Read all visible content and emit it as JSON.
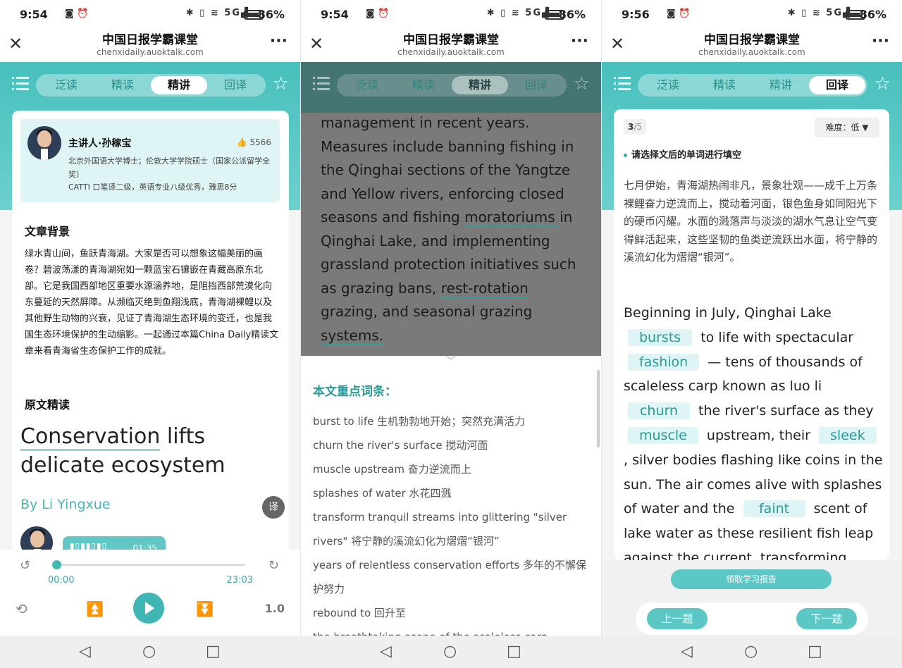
{
  "common": {
    "app_title": "中国日报学霸课堂",
    "app_url": "chenxidaily.auoktalk.com",
    "battery": "86%",
    "tabs": [
      "泛读",
      "精读",
      "精讲",
      "回译"
    ]
  },
  "p1": {
    "time": "9:54",
    "lecturer": {
      "name": "主讲人·孙稼宝",
      "likes": "5566",
      "desc1": "北京外国语大学博士；伦敦大学学院硕士（国家公派留学全奖）",
      "desc2": "CATTI 口笔译二级，英语专业八级优秀，雅思8分"
    },
    "bg_title": "文章背景",
    "bg_text": "绿水青山间，鱼跃青海湖。大家是否可以想象这幅美丽的画卷？碧波荡漾的青海湖宛如一颗蓝宝石镶嵌在青藏高原东北部。它是我国西部地区重要水源涵养地，是阻挡西部荒漠化向东蔓延的天然屏障。从濒临灭绝到鱼翔浅底，青海湖裸鲤以及其他野生动物的兴衰，见证了青海湖生态环境的变迁，也是我国生态环境保护的生动缩影。一起通过本篇China Daily精读文章来看青海省生态保护工作的成就。",
    "reading_title": "原文精读",
    "headline_a": "Conservation",
    "headline_b": " lifts delicate ecosystem",
    "byline": "By Li Yingxue",
    "translate_label": "译",
    "audio_duration": "01:35",
    "time_current": "00:00",
    "time_total": "23:03",
    "progress": 0.0,
    "speed": "1.0"
  },
  "p2": {
    "time": "9:54",
    "t1": "management in recent years. Measures include banning fishing in the Qinghai sections of the Yangtze and Yellow rivers, enforcing closed seasons and fishing ",
    "v1": "moratoriums ",
    "t2": "in Qinghai Lake, and implementing grassland protection initiatives such as grazing bans, ",
    "v2": "rest-rotation ",
    "t3": "grazing, and seasonal grazing ",
    "v3": "systems.",
    "sheet_title": "本文重点词条：",
    "vocab": [
      "burst to life 生机勃勃地开始；突然充满活力",
      "churn the river's surface 搅动河面",
      "muscle upstream 奋力逆流而上",
      "splashes of water 水花四溅",
      "transform tranquil streams into glittering \"silver rivers\" 将宁静的溪流幻化为熠熠“银河”",
      "years of relentless conservation efforts 多年的不懈保护努力",
      "rebound to 回升至",
      "the breathtaking scene of the scaleless carp"
    ]
  },
  "p3": {
    "time": "9:56",
    "progress_current": "3",
    "progress_total": "/5",
    "difficulty": "难度：低 ▼",
    "instruction": "请选择文后的单词进行填空",
    "cn_text": "七月伊始，青海湖热闹非凡，景象壮观——成千上万条裸鲤奋力逆流而上，搅动着河面，银色鱼身如同阳光下的硬币闪耀。水面的溅落声与淡淡的湖水气息让空气变得鲜活起来，这些坚韧的鱼类逆流跃出水面，将宁静的溪流幻化为熠熠“银河”。",
    "en": {
      "s1": "Beginning in July, Qinghai Lake",
      "b1": "bursts",
      "s2": "to life with spectacular",
      "b2": "fashion",
      "s3": "— tens of thousands of scaleless carp known as luo li",
      "b3": "churn",
      "s4": "the river's surface as they",
      "b4": "muscle",
      "s5": "upstream, their",
      "b5": "sleek",
      "s6": ", silver bodies flashing like coins in the sun. The air comes alive with splashes of water and the",
      "b6": "faint",
      "s7": "scent of lake water as these resilient fish leap against the current, transforming tranquil"
    },
    "report_label": "领取学习报告",
    "prev_label": "上一题",
    "next_label": "下一题"
  },
  "icons": [
    "close-icon",
    "more-icon",
    "menu-icon",
    "star-icon",
    "thumbs-up-icon",
    "rewind-5-icon",
    "forward-5-icon",
    "loop-icon",
    "prev-track-icon",
    "play-icon",
    "next-track-icon",
    "chevron-down-icon",
    "back-nav-icon",
    "home-nav-icon",
    "recents-nav-icon"
  ],
  "colors": {
    "accent": "#48c0bd",
    "blank_bg": "#dff5f5",
    "link_text": "#2a9a97"
  }
}
